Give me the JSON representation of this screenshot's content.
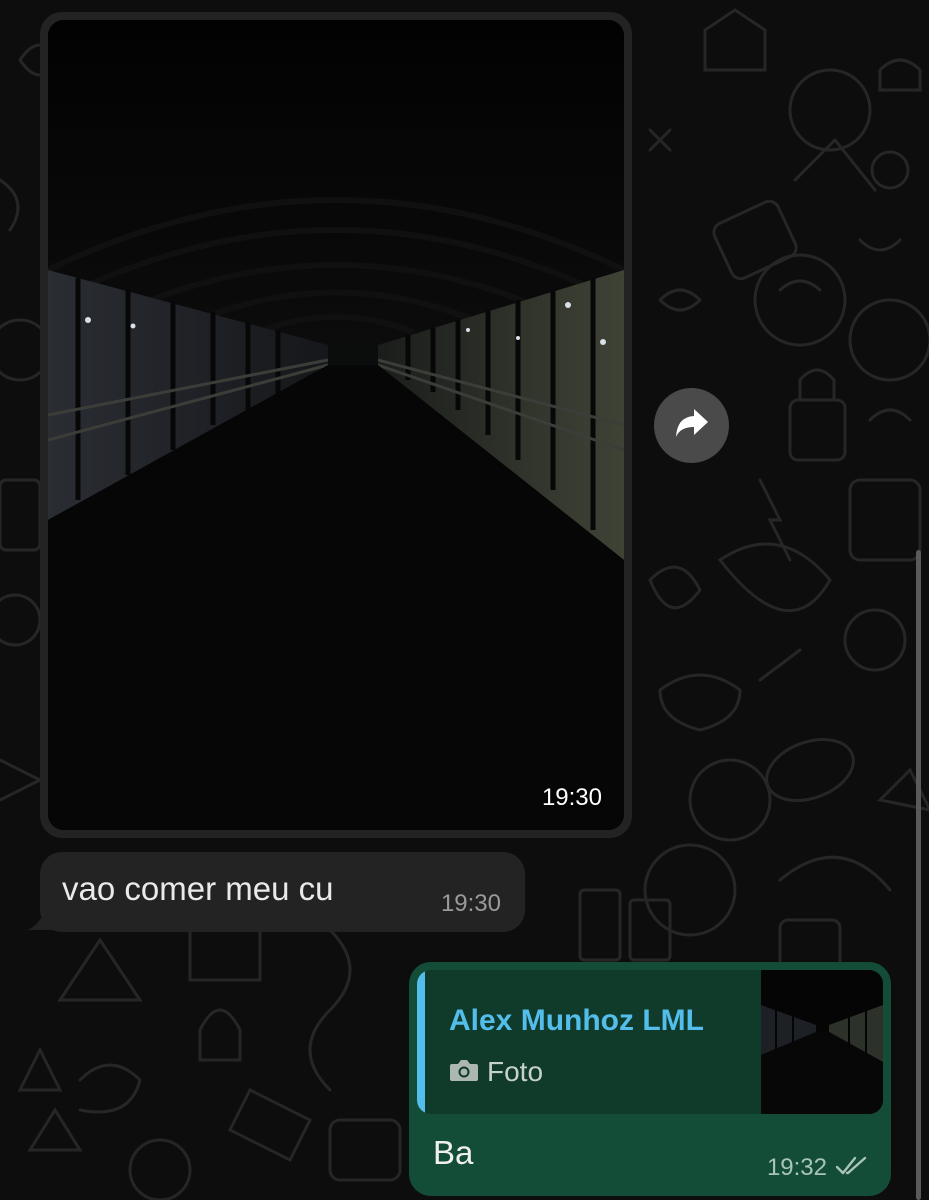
{
  "chat": {
    "messages": [
      {
        "type": "photo",
        "direction": "incoming",
        "time": "19:30"
      },
      {
        "type": "text",
        "direction": "incoming",
        "text": "vao comer meu cu",
        "time": "19:30"
      },
      {
        "type": "reply",
        "direction": "outgoing",
        "quoted_author": "Alex Munhoz LML",
        "quoted_type": "Foto",
        "text": "Ba",
        "time": "19:32",
        "status_icon": "double-check-icon"
      }
    ],
    "forward_icon": "forward-arrow-icon"
  },
  "colors": {
    "incoming_bubble": "#232323",
    "outgoing_bubble": "#144d37",
    "quote_accent": "#53bdeb",
    "wallpaper": "#0d0d0d"
  }
}
